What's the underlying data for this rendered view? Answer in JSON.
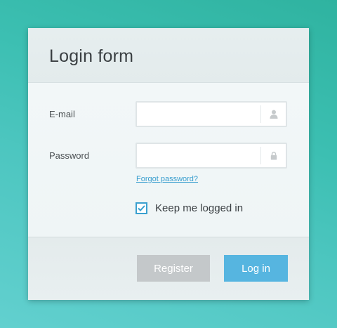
{
  "form": {
    "title": "Login form",
    "email_label": "E-mail",
    "email_value": "",
    "email_icon": "user-icon",
    "password_label": "Password",
    "password_value": "",
    "password_icon": "lock-icon",
    "forgot_link": "Forgot password?",
    "remember_label": "Keep me logged in",
    "remember_checked": true,
    "register_button": "Register",
    "login_button": "Log in"
  },
  "colors": {
    "accent": "#56b5e0",
    "link": "#3a9fcf",
    "register_button": "#c4c8ca",
    "background": "#3cbfb2"
  }
}
